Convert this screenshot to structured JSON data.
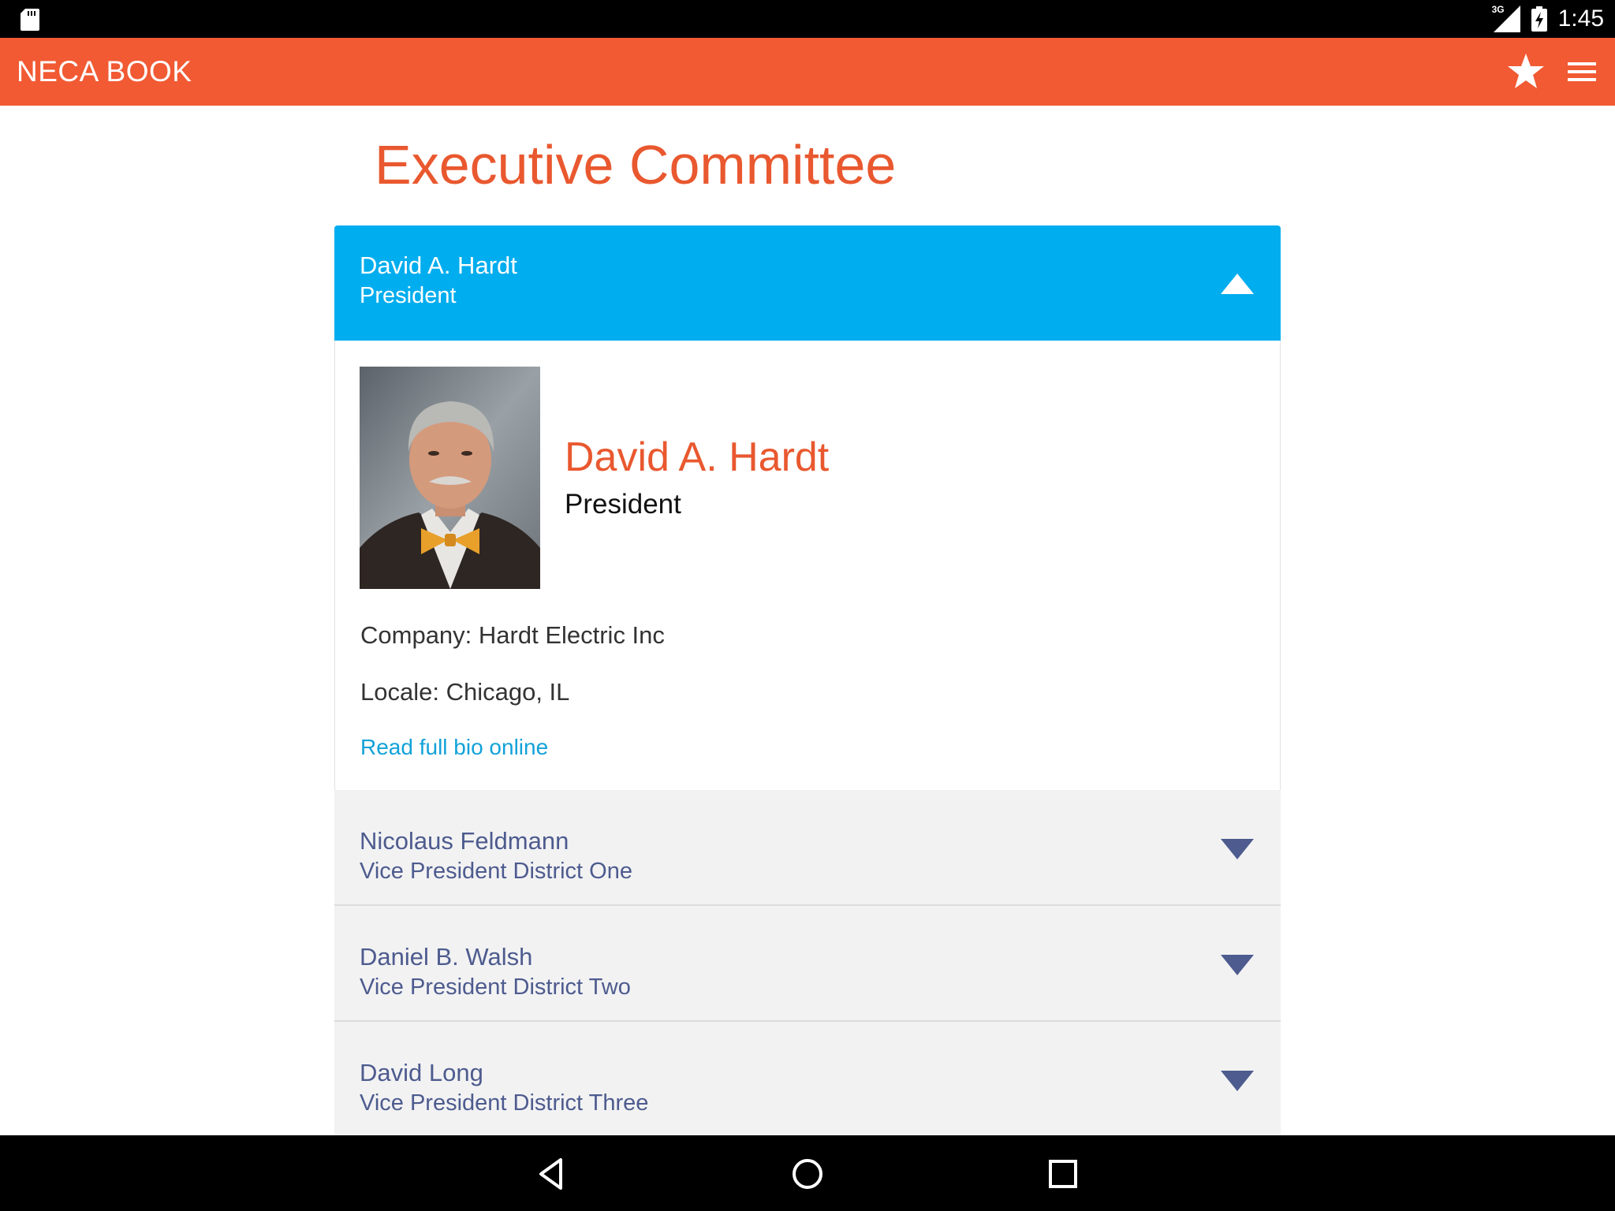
{
  "status_bar": {
    "network": "3G",
    "time": "1:45"
  },
  "app_bar": {
    "title": "NECA BOOK",
    "icons": [
      "star-icon",
      "menu-icon"
    ]
  },
  "page": {
    "title": "Executive Committee"
  },
  "members": [
    {
      "name": "David A. Hardt",
      "role": "President",
      "expanded": true
    },
    {
      "name": "Nicolaus Feldmann",
      "role": "Vice President District One",
      "expanded": false
    },
    {
      "name": "Daniel B. Walsh",
      "role": "Vice President District Two",
      "expanded": false
    },
    {
      "name": "David Long",
      "role": "Vice President District Three",
      "expanded": false
    }
  ],
  "detail": {
    "name": "David A. Hardt",
    "role": "President",
    "company": "Company: Hardt Electric Inc",
    "locale": "Locale: Chicago, IL",
    "bio_link": "Read full bio online"
  },
  "colors": {
    "accent": "#f15a33",
    "header_open": "#00adee",
    "header_closed": "#f2f2f3",
    "text_muted": "#4d5b8e",
    "link": "#12a2d8"
  },
  "nav_bar": {
    "icons": [
      "back-icon",
      "home-icon",
      "recents-icon"
    ]
  }
}
